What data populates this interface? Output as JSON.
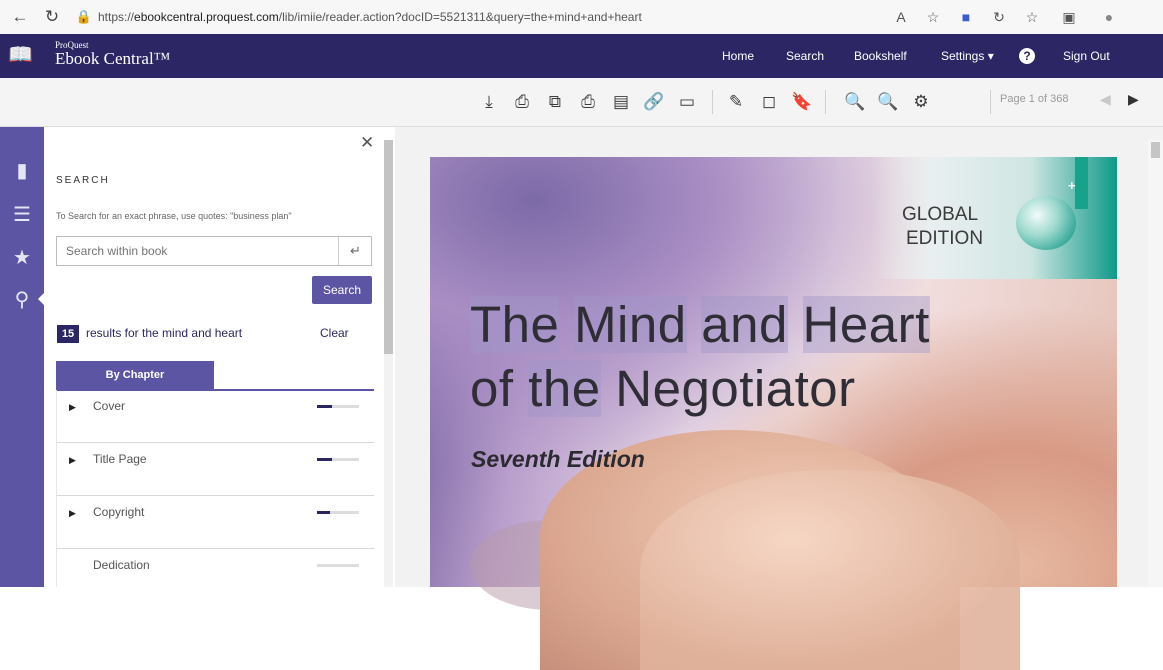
{
  "browser": {
    "url_prefix": "https://",
    "url_domain": "ebookcentral.proquest.com",
    "url_path": "/lib/imiie/reader.action?docID=5521311&query=the+mind+and+heart"
  },
  "app": {
    "brand_small": "ProQuest",
    "brand_name": "Ebook Central™",
    "nav": {
      "home": "Home",
      "search": "Search",
      "bookshelf": "Bookshelf",
      "settings": "Settings ▾",
      "help": "?",
      "sign_out": "Sign Out"
    }
  },
  "toolbar": {
    "page_info": "Page 1 of 368"
  },
  "search_panel": {
    "heading": "SEARCH",
    "hint": "To Search for an exact phrase, use quotes: \"business plan\"",
    "input_placeholder": "Search within book",
    "search_button": "Search",
    "result_count": "15",
    "results_for": "results for",
    "query": "the mind and heart",
    "clear": "Clear",
    "tab": "By Chapter",
    "chapters": [
      {
        "label": "Cover",
        "has_caret": true,
        "relevance": 0.35
      },
      {
        "label": "Title Page",
        "has_caret": true,
        "relevance": 0.35
      },
      {
        "label": "Copyright",
        "has_caret": true,
        "relevance": 0.3
      },
      {
        "label": "Dedication",
        "has_caret": false,
        "relevance": 0
      }
    ]
  },
  "book": {
    "global_line1": "GLOBAL",
    "global_line2": "EDITION",
    "title_words_line1": [
      "The",
      "Mind",
      "and",
      "Heart"
    ],
    "title_words_line2": [
      "of",
      "the",
      "Negotiator"
    ],
    "edition": "Seventh Edition"
  },
  "colors": {
    "header": "#2c2764",
    "accent": "#5b55a3",
    "teal": "#17a28c"
  }
}
